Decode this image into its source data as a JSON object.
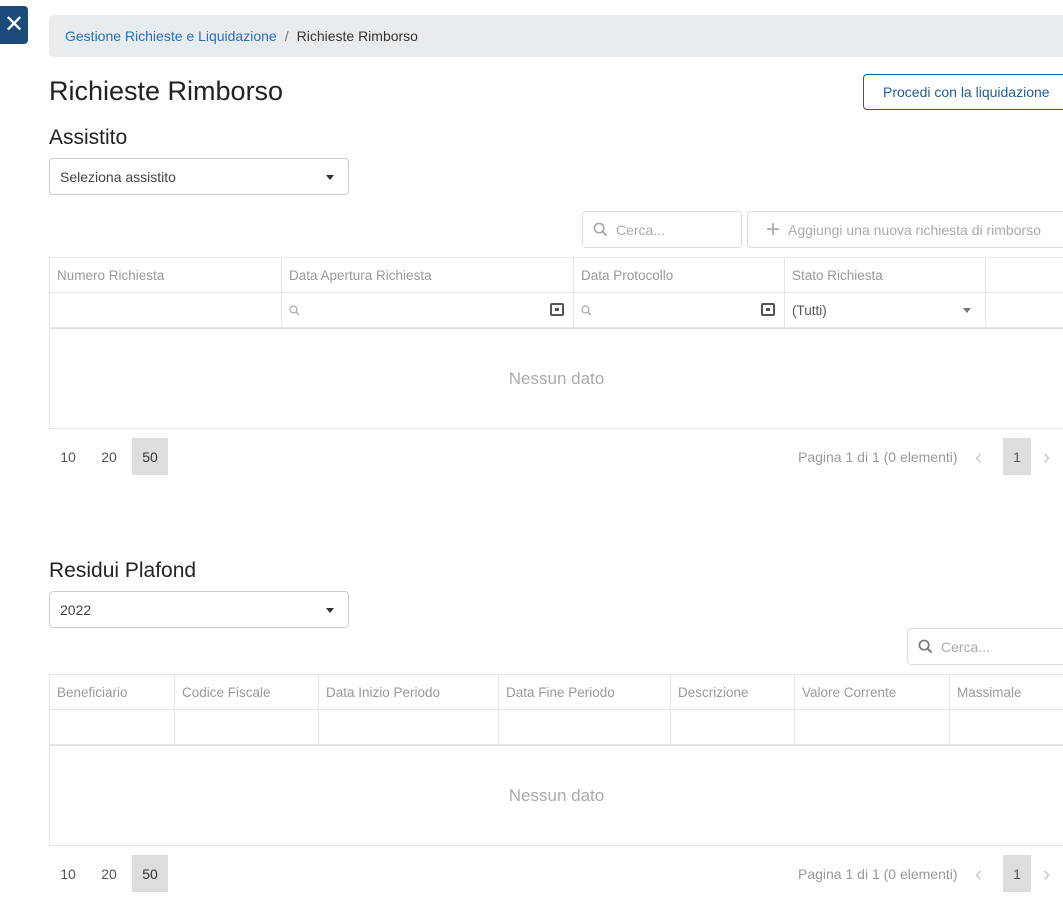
{
  "breadcrumb": {
    "parent": "Gestione Richieste e Liquidazione",
    "separator": "/",
    "current": "Richieste Rimborso"
  },
  "page_title": "Richieste Rimborso",
  "proceed_button": "Procedi con la liquidazione",
  "assistito": {
    "title": "Assistito",
    "select_value": "Seleziona assistito"
  },
  "rimborso_toolbar": {
    "search_placeholder": "Cerca...",
    "add_label": "Aggiungi una nuova richiesta di rimborso"
  },
  "rimborso_grid": {
    "columns": [
      "Numero Richiesta",
      "Data Apertura Richiesta",
      "Data Protocollo",
      "Stato Richiesta"
    ],
    "status_filter": "(Tutti)",
    "no_data": "Nessun dato"
  },
  "rimborso_pager": {
    "sizes": [
      "10",
      "20",
      "50"
    ],
    "active_size": "50",
    "info": "Pagina 1 di 1 (0 elementi)",
    "page": "1"
  },
  "plafond": {
    "title": "Residui Plafond",
    "select_value": "2022",
    "search_placeholder": "Cerca...",
    "columns": [
      "Beneficiario",
      "Codice Fiscale",
      "Data Inizio Periodo",
      "Data Fine Periodo",
      "Descrizione",
      "Valore Corrente",
      "Massimale"
    ],
    "no_data": "Nessun dato"
  },
  "plafond_pager": {
    "sizes": [
      "10",
      "20",
      "50"
    ],
    "active_size": "50",
    "info": "Pagina 1 di 1 (0 elementi)",
    "page": "1"
  },
  "icons": {
    "close": "close-icon",
    "search": "search-icon",
    "plus": "plus-icon",
    "calendar": "calendar-icon",
    "chevron_left": "chevron-left-icon",
    "chevron_right": "chevron-right-icon"
  },
  "colors": {
    "close_bg": "#1a4a7a",
    "link": "#2a6fb5",
    "primary_outline": "#1f5d96",
    "breadcrumb_bg": "#e9ecef"
  }
}
